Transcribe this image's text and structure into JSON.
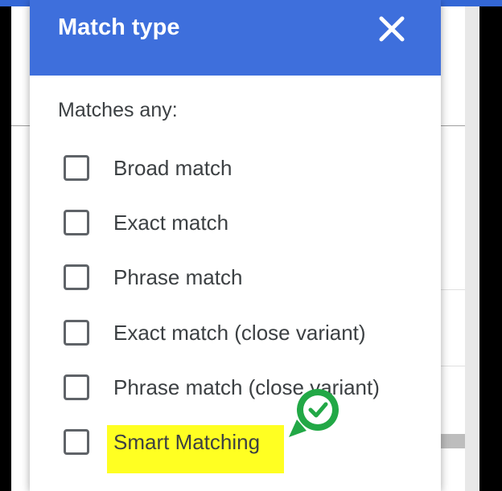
{
  "dialog": {
    "title": "Match type",
    "subtitle": "Matches any:",
    "options": [
      {
        "label": "Broad match",
        "checked": false
      },
      {
        "label": "Exact match",
        "checked": false
      },
      {
        "label": "Phrase match",
        "checked": false
      },
      {
        "label": "Exact match (close variant)",
        "checked": false
      },
      {
        "label": "Phrase match (close variant)",
        "checked": false
      },
      {
        "label": "Smart Matching",
        "checked": false,
        "highlighted": true
      }
    ]
  },
  "icons": {
    "close": "close-icon",
    "badge": "check-badge-icon"
  },
  "colors": {
    "header": "#3e6fdc",
    "highlight": "#ffff22",
    "badge": "#22a846"
  }
}
